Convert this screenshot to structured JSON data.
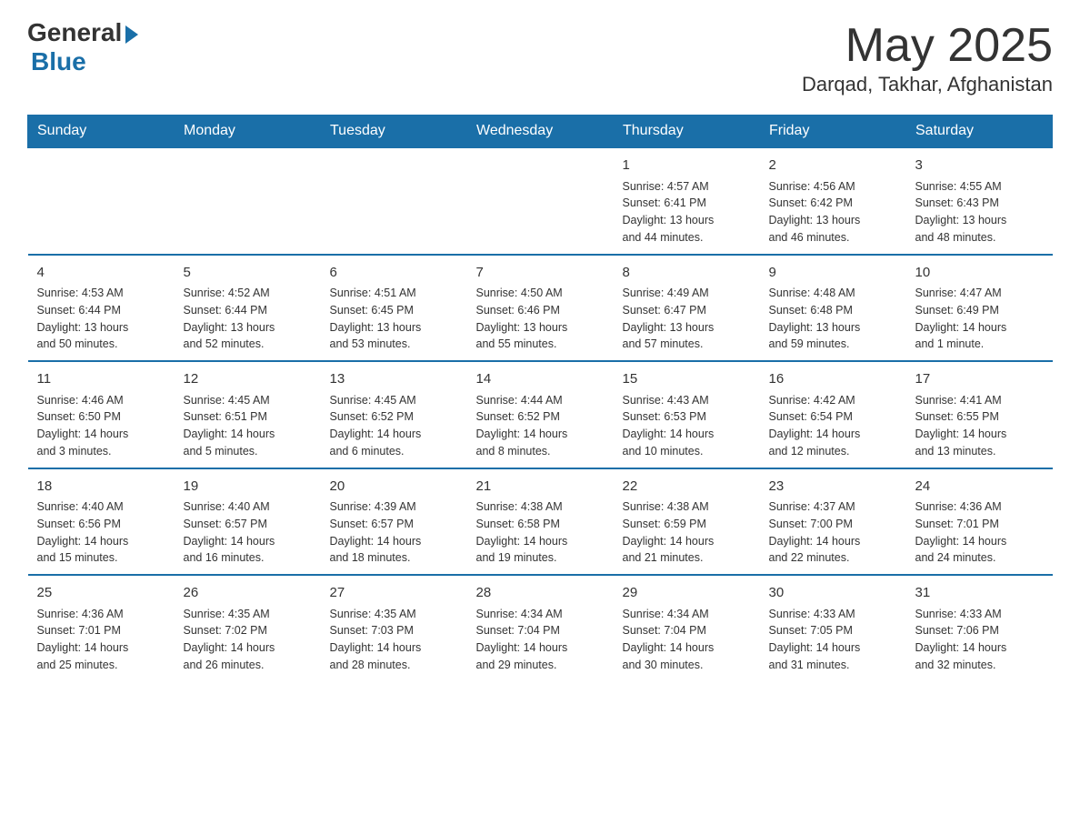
{
  "header": {
    "logo_general": "General",
    "logo_blue": "Blue",
    "month_title": "May 2025",
    "location": "Darqad, Takhar, Afghanistan"
  },
  "days_of_week": [
    "Sunday",
    "Monday",
    "Tuesday",
    "Wednesday",
    "Thursday",
    "Friday",
    "Saturday"
  ],
  "weeks": [
    {
      "days": [
        {
          "number": "",
          "info": ""
        },
        {
          "number": "",
          "info": ""
        },
        {
          "number": "",
          "info": ""
        },
        {
          "number": "",
          "info": ""
        },
        {
          "number": "1",
          "info": "Sunrise: 4:57 AM\nSunset: 6:41 PM\nDaylight: 13 hours\nand 44 minutes."
        },
        {
          "number": "2",
          "info": "Sunrise: 4:56 AM\nSunset: 6:42 PM\nDaylight: 13 hours\nand 46 minutes."
        },
        {
          "number": "3",
          "info": "Sunrise: 4:55 AM\nSunset: 6:43 PM\nDaylight: 13 hours\nand 48 minutes."
        }
      ]
    },
    {
      "days": [
        {
          "number": "4",
          "info": "Sunrise: 4:53 AM\nSunset: 6:44 PM\nDaylight: 13 hours\nand 50 minutes."
        },
        {
          "number": "5",
          "info": "Sunrise: 4:52 AM\nSunset: 6:44 PM\nDaylight: 13 hours\nand 52 minutes."
        },
        {
          "number": "6",
          "info": "Sunrise: 4:51 AM\nSunset: 6:45 PM\nDaylight: 13 hours\nand 53 minutes."
        },
        {
          "number": "7",
          "info": "Sunrise: 4:50 AM\nSunset: 6:46 PM\nDaylight: 13 hours\nand 55 minutes."
        },
        {
          "number": "8",
          "info": "Sunrise: 4:49 AM\nSunset: 6:47 PM\nDaylight: 13 hours\nand 57 minutes."
        },
        {
          "number": "9",
          "info": "Sunrise: 4:48 AM\nSunset: 6:48 PM\nDaylight: 13 hours\nand 59 minutes."
        },
        {
          "number": "10",
          "info": "Sunrise: 4:47 AM\nSunset: 6:49 PM\nDaylight: 14 hours\nand 1 minute."
        }
      ]
    },
    {
      "days": [
        {
          "number": "11",
          "info": "Sunrise: 4:46 AM\nSunset: 6:50 PM\nDaylight: 14 hours\nand 3 minutes."
        },
        {
          "number": "12",
          "info": "Sunrise: 4:45 AM\nSunset: 6:51 PM\nDaylight: 14 hours\nand 5 minutes."
        },
        {
          "number": "13",
          "info": "Sunrise: 4:45 AM\nSunset: 6:52 PM\nDaylight: 14 hours\nand 6 minutes."
        },
        {
          "number": "14",
          "info": "Sunrise: 4:44 AM\nSunset: 6:52 PM\nDaylight: 14 hours\nand 8 minutes."
        },
        {
          "number": "15",
          "info": "Sunrise: 4:43 AM\nSunset: 6:53 PM\nDaylight: 14 hours\nand 10 minutes."
        },
        {
          "number": "16",
          "info": "Sunrise: 4:42 AM\nSunset: 6:54 PM\nDaylight: 14 hours\nand 12 minutes."
        },
        {
          "number": "17",
          "info": "Sunrise: 4:41 AM\nSunset: 6:55 PM\nDaylight: 14 hours\nand 13 minutes."
        }
      ]
    },
    {
      "days": [
        {
          "number": "18",
          "info": "Sunrise: 4:40 AM\nSunset: 6:56 PM\nDaylight: 14 hours\nand 15 minutes."
        },
        {
          "number": "19",
          "info": "Sunrise: 4:40 AM\nSunset: 6:57 PM\nDaylight: 14 hours\nand 16 minutes."
        },
        {
          "number": "20",
          "info": "Sunrise: 4:39 AM\nSunset: 6:57 PM\nDaylight: 14 hours\nand 18 minutes."
        },
        {
          "number": "21",
          "info": "Sunrise: 4:38 AM\nSunset: 6:58 PM\nDaylight: 14 hours\nand 19 minutes."
        },
        {
          "number": "22",
          "info": "Sunrise: 4:38 AM\nSunset: 6:59 PM\nDaylight: 14 hours\nand 21 minutes."
        },
        {
          "number": "23",
          "info": "Sunrise: 4:37 AM\nSunset: 7:00 PM\nDaylight: 14 hours\nand 22 minutes."
        },
        {
          "number": "24",
          "info": "Sunrise: 4:36 AM\nSunset: 7:01 PM\nDaylight: 14 hours\nand 24 minutes."
        }
      ]
    },
    {
      "days": [
        {
          "number": "25",
          "info": "Sunrise: 4:36 AM\nSunset: 7:01 PM\nDaylight: 14 hours\nand 25 minutes."
        },
        {
          "number": "26",
          "info": "Sunrise: 4:35 AM\nSunset: 7:02 PM\nDaylight: 14 hours\nand 26 minutes."
        },
        {
          "number": "27",
          "info": "Sunrise: 4:35 AM\nSunset: 7:03 PM\nDaylight: 14 hours\nand 28 minutes."
        },
        {
          "number": "28",
          "info": "Sunrise: 4:34 AM\nSunset: 7:04 PM\nDaylight: 14 hours\nand 29 minutes."
        },
        {
          "number": "29",
          "info": "Sunrise: 4:34 AM\nSunset: 7:04 PM\nDaylight: 14 hours\nand 30 minutes."
        },
        {
          "number": "30",
          "info": "Sunrise: 4:33 AM\nSunset: 7:05 PM\nDaylight: 14 hours\nand 31 minutes."
        },
        {
          "number": "31",
          "info": "Sunrise: 4:33 AM\nSunset: 7:06 PM\nDaylight: 14 hours\nand 32 minutes."
        }
      ]
    }
  ]
}
